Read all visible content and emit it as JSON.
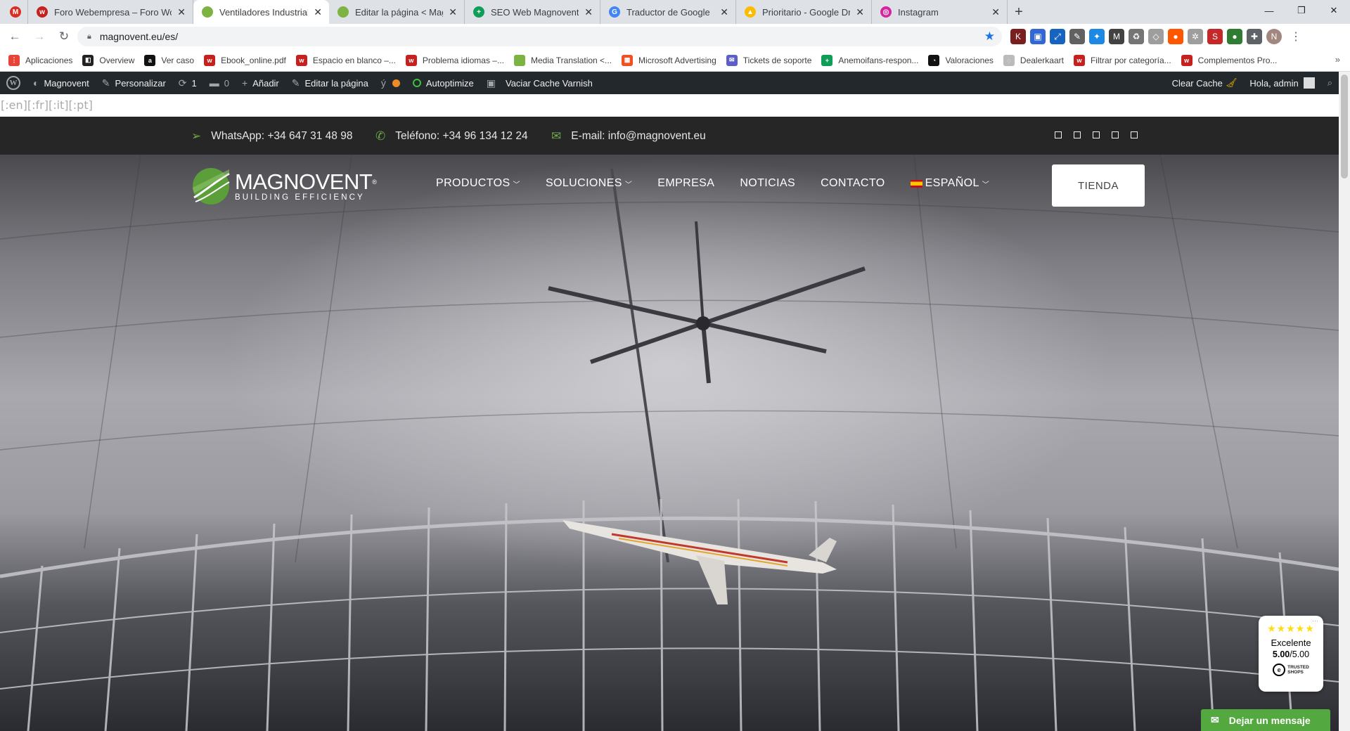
{
  "browser": {
    "tabs": [
      {
        "title": "",
        "icon": "gmail-icon",
        "color": "#d93025",
        "glyph": "M"
      },
      {
        "title": "Foro Webempresa – Foro WordPress",
        "icon": "webempresa-icon",
        "color": "#c5221f",
        "glyph": "w"
      },
      {
        "title": "Ventiladores Industriales de Techo",
        "icon": "magnovent-leaf-icon",
        "color": "#7cb342",
        "glyph": "",
        "active": true
      },
      {
        "title": "Editar la página < Magnovent — WordPress",
        "icon": "magnovent-leaf-icon",
        "color": "#7cb342",
        "glyph": ""
      },
      {
        "title": "SEO Web Magnovent - Hojas de cálculo",
        "icon": "sheets-icon",
        "color": "#0f9d58",
        "glyph": "+"
      },
      {
        "title": "Traductor de Google",
        "icon": "google-translate-icon",
        "color": "#4285f4",
        "glyph": "G"
      },
      {
        "title": "Prioritario - Google Drive",
        "icon": "google-drive-icon",
        "color": "#fbbc04",
        "glyph": "▲"
      },
      {
        "title": "Instagram",
        "icon": "instagram-icon",
        "color": "#d6249f",
        "glyph": "◎"
      }
    ],
    "url": "magnovent.eu/es/",
    "bookmarks": [
      {
        "label": "Aplicaciones",
        "icon": "apps-grid-icon",
        "color": "#ea4335",
        "glyph": "⋮"
      },
      {
        "label": "Overview",
        "icon": "overview-icon",
        "color": "#222222",
        "glyph": "◧"
      },
      {
        "label": "Ver caso",
        "icon": "amazon-icon",
        "color": "#111111",
        "glyph": "a"
      },
      {
        "label": "Ebook_online.pdf",
        "icon": "webempresa-icon",
        "color": "#c5221f",
        "glyph": "w"
      },
      {
        "label": "Espacio en blanco –...",
        "icon": "webempresa-icon",
        "color": "#c5221f",
        "glyph": "w"
      },
      {
        "label": "Problema idiomas –...",
        "icon": "webempresa-icon",
        "color": "#c5221f",
        "glyph": "w"
      },
      {
        "label": "Media Translation <...",
        "icon": "magnovent-leaf-icon",
        "color": "#7cb342",
        "glyph": ""
      },
      {
        "label": "Microsoft Advertising",
        "icon": "microsoft-icon",
        "color": "#f25022",
        "glyph": "▦"
      },
      {
        "label": "Tickets de soporte",
        "icon": "tickets-icon",
        "color": "#5b5fc7",
        "glyph": "✉"
      },
      {
        "label": "Anemoifans-respon...",
        "icon": "sheets-icon",
        "color": "#0f9d58",
        "glyph": "+"
      },
      {
        "label": "Valoraciones",
        "icon": "valoraciones-icon",
        "color": "#111111",
        "glyph": "◔"
      },
      {
        "label": "Dealerkaart",
        "icon": "dealerkaart-icon",
        "color": "#bbbbbb",
        "glyph": "◌"
      },
      {
        "label": "Filtrar por categoría...",
        "icon": "webempresa-icon",
        "color": "#c5221f",
        "glyph": "w"
      },
      {
        "label": "Complementos Pro...",
        "icon": "webempresa-icon",
        "color": "#c5221f",
        "glyph": "w"
      }
    ],
    "profile_initial": "N",
    "extensions": [
      {
        "icon": "extension-red-k-icon",
        "color": "#7a1f1f",
        "glyph": "K"
      },
      {
        "icon": "extension-blue-box-icon",
        "color": "#3367d6",
        "glyph": "▣"
      },
      {
        "icon": "extension-screenshot-icon",
        "color": "#1565c0",
        "glyph": "⤢"
      },
      {
        "icon": "extension-eyedropper-icon",
        "color": "#616161",
        "glyph": "✎"
      },
      {
        "icon": "extension-messenger-icon",
        "color": "#1e88e5",
        "glyph": "✦"
      },
      {
        "icon": "extension-m-icon",
        "color": "#424242",
        "glyph": "M"
      },
      {
        "icon": "extension-recycle-icon",
        "color": "#757575",
        "glyph": "♻"
      },
      {
        "icon": "extension-tag-icon",
        "color": "#9e9e9e",
        "glyph": "◇"
      },
      {
        "icon": "extension-reddit-icon",
        "color": "#ff5700",
        "glyph": "●"
      },
      {
        "icon": "extension-gear-icon",
        "color": "#9e9e9e",
        "glyph": "✲"
      },
      {
        "icon": "extension-s-red-icon",
        "color": "#c62828",
        "glyph": "S"
      },
      {
        "icon": "extension-green-drop-icon",
        "color": "#2e7d32",
        "glyph": "●"
      },
      {
        "icon": "extensions-puzzle-icon",
        "color": "#5f6368",
        "glyph": "✚"
      }
    ]
  },
  "wp_admin": {
    "site_name": "Magnovent",
    "customize": "Personalizar",
    "updates": "1",
    "comments": "0",
    "add_new": "Añadir",
    "edit_page": "Editar la página",
    "autoptimize": "Autoptimize",
    "varnish": "Vaciar Cache Varnish",
    "clear_cache": "Clear Cache",
    "greeting": "Hola, admin"
  },
  "qtranslate_tags": "[:en][:fr][:it][:pt]",
  "topbar": {
    "whatsapp": "WhatsApp: +34 647 31 48 98",
    "phone": "Teléfono: +34 96 134 12 24",
    "email": "E-mail: info@magnovent.eu",
    "social_count": 5
  },
  "header": {
    "logo_name": "MAGNOVENT",
    "logo_registered": "®",
    "logo_tagline": "BUILDING EFFICIENCY",
    "nav": [
      "PRODUCTOS",
      "SOLUCIONES",
      "EMPRESA",
      "NOTICIAS",
      "CONTACTO",
      "ESPAÑOL"
    ],
    "shop_button": "TIENDA"
  },
  "trusted_badge": {
    "stars": "★★★★★",
    "rating_word": "Excelente",
    "score": "5.00",
    "score_max": "/5.00",
    "brand_line1": "TRUSTED",
    "brand_line2": "SHOPS"
  },
  "chat": {
    "label": "Dejar un mensaje"
  },
  "colors": {
    "brand_green": "#6fa84b",
    "wp_bar": "#23282d",
    "chat_green": "#53a93f",
    "topbar": "#262626"
  }
}
